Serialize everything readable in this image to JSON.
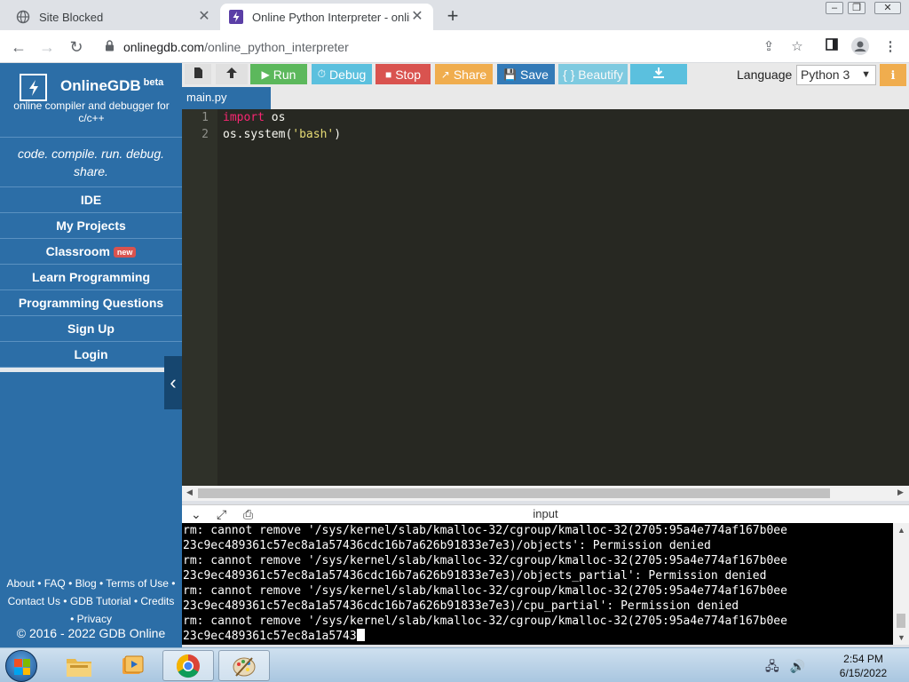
{
  "browser": {
    "tabs": [
      {
        "title": "Site Blocked",
        "active": false
      },
      {
        "title": "Online Python Interpreter - onlin",
        "active": true
      }
    ],
    "address": {
      "domain": "onlinegdb.com",
      "path": "/online_python_interpreter"
    }
  },
  "sidebar": {
    "brand": "OnlineGDB",
    "brand_sup": "beta",
    "brand_sub": "online compiler and debugger for c/c++",
    "tagline": "code. compile. run. debug. share.",
    "nav": [
      {
        "label": "IDE"
      },
      {
        "label": "My Projects"
      },
      {
        "label": "Classroom",
        "badge": "new"
      },
      {
        "label": "Learn Programming"
      },
      {
        "label": "Programming Questions"
      },
      {
        "label": "Sign Up"
      },
      {
        "label": "Login"
      }
    ],
    "footer": {
      "line1": "About • FAQ • Blog • Terms of Use •",
      "line2": "Contact Us • GDB Tutorial • Credits",
      "line3": "• Privacy",
      "copyright": "© 2016 - 2022 GDB Online"
    }
  },
  "toolbar": {
    "run": "Run",
    "debug": "Debug",
    "stop": "Stop",
    "share": "Share",
    "save": "Save",
    "beautify": "{ } Beautify",
    "language_label": "Language",
    "language_value": "Python 3",
    "colors": {
      "run": "#5cb85c",
      "debug": "#5bc0de",
      "stop": "#d9534f",
      "share": "#f0ad4e",
      "save": "#337ab7",
      "beautify": "#5bc0de",
      "download": "#5bc0de",
      "file_btn": "#e0e0e0"
    }
  },
  "editor": {
    "file_tab": "main.py",
    "lines": [
      {
        "num": "1",
        "kw": "import",
        "rest": " os"
      },
      {
        "num": "2",
        "pre": "os.system(",
        "str": "'bash'",
        "post": ")"
      }
    ]
  },
  "output": {
    "title": "input",
    "lines": [
      "rm: cannot remove '/sys/kernel/slab/kmalloc-32/cgroup/kmalloc-32(2705:95a4e774af167b0ee",
      "23c9ec489361c57ec8a1a57436cdc16b7a626b91833e7e3)/objects': Permission denied",
      "rm: cannot remove '/sys/kernel/slab/kmalloc-32/cgroup/kmalloc-32(2705:95a4e774af167b0ee",
      "23c9ec489361c57ec8a1a57436cdc16b7a626b91833e7e3)/objects_partial': Permission denied",
      "rm: cannot remove '/sys/kernel/slab/kmalloc-32/cgroup/kmalloc-32(2705:95a4e774af167b0ee",
      "23c9ec489361c57ec8a1a57436cdc16b7a626b91833e7e3)/cpu_partial': Permission denied",
      "rm: cannot remove '/sys/kernel/slab/kmalloc-32/cgroup/kmalloc-32(2705:95a4e774af167b0ee",
      "23c9ec489361c57ec8a1a5743"
    ]
  },
  "taskbar": {
    "time": "2:54 PM",
    "date": "6/15/2022",
    "apps": [
      "explorer-icon",
      "media-player-icon",
      "chrome-icon",
      "paint-icon"
    ]
  }
}
